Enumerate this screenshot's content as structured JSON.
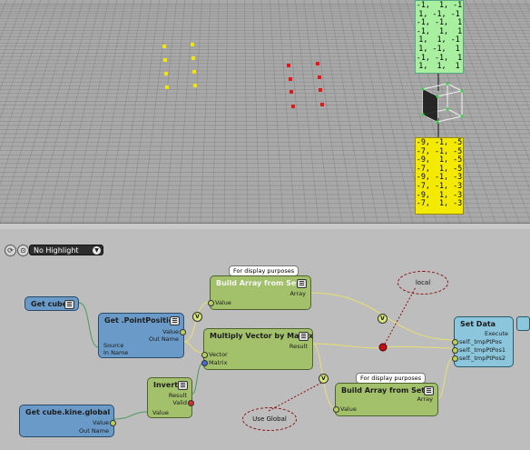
{
  "viewport": {
    "matrix_green": [
      "-1,  1, -1",
      "1, -1, -1",
      "-1, -1,  1",
      "-1,  1,  1",
      "1,  1, -1",
      "1, -1,  1",
      "-1, -1,  1",
      "1,  1,  1"
    ],
    "matrix_yellow": [
      "-9, -1, -5",
      "-7, -1, -5",
      "-9,  1, -5",
      "-7,  1, -5",
      "-9, -1, -3",
      "-7, -1, -3",
      "-9,  1, -3",
      "-7,  1, -3"
    ]
  },
  "toolbar": {
    "highlight_value": "No Highlight"
  },
  "nodes": {
    "get_cube": {
      "title": "Get cube"
    },
    "get_cube_kine": {
      "title": "Get cube.kine.global",
      "ports": [
        "Value",
        "Out Name"
      ]
    },
    "get_pointposition": {
      "title": "Get .PointPosition",
      "ports_out": [
        "Value",
        "Out Name"
      ],
      "ports_in": [
        "Source",
        "In Name"
      ]
    },
    "build_array_1": {
      "title": "Build Array from Set",
      "port_in": "Value",
      "port_out": "Array",
      "tag": "For display purposes"
    },
    "multiply_vector": {
      "title": "Multiply Vector by Matrix",
      "port_out": "Result",
      "ports_in": [
        "Vector",
        "Matrix"
      ]
    },
    "invert": {
      "title": "Invert",
      "ports_out": [
        "Result",
        "Valid"
      ],
      "port_in": "Value"
    },
    "build_array_2": {
      "title": "Build Array from Set",
      "port_in": "Value",
      "port_out": "Array",
      "tag": "For display purposes"
    },
    "set_data": {
      "title": "Set Data",
      "port_exec": "Execute",
      "ports_in": [
        "self._tmpPtPos",
        "self._tmpPtPos1",
        "self._tmpPtPos2"
      ]
    }
  },
  "bubbles": {
    "local": "local",
    "use_global": "Use Global"
  },
  "badges": {
    "v": "V"
  }
}
